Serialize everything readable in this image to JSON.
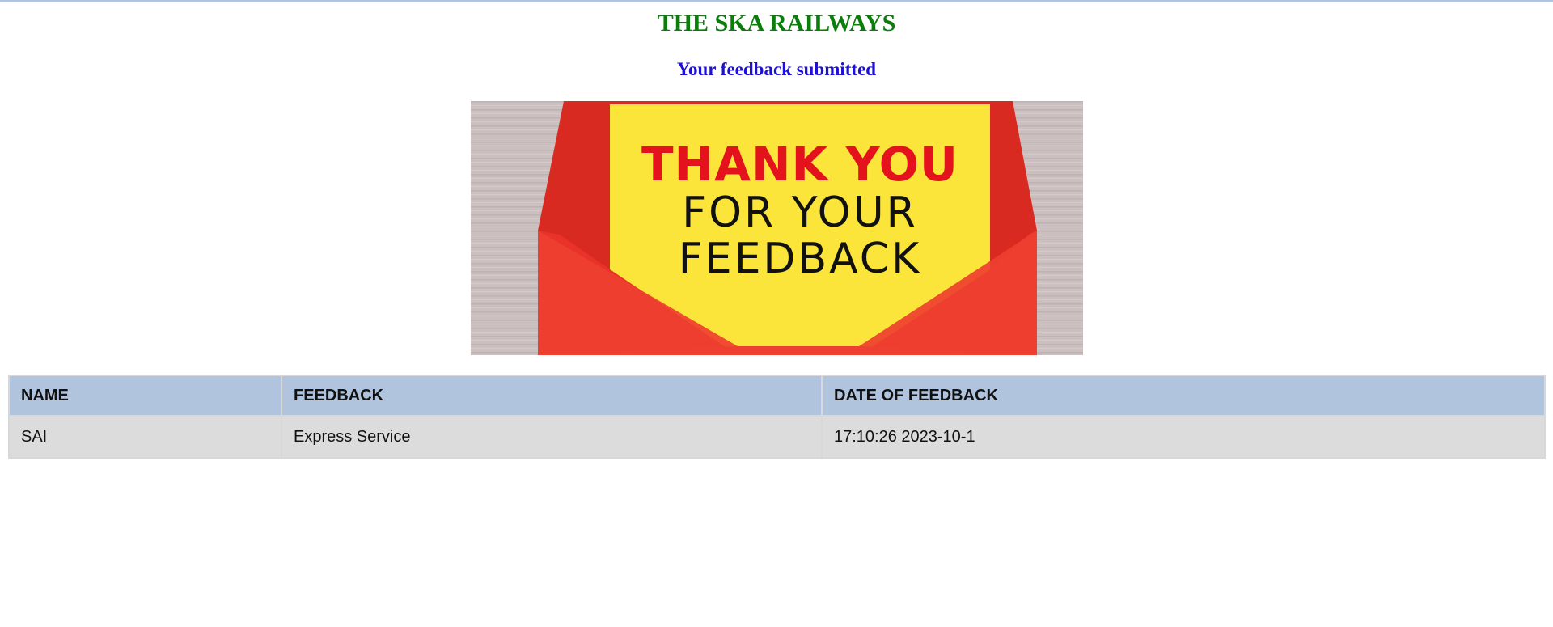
{
  "page": {
    "title": "THE SKA RAILWAYS",
    "status_message": "Your feedback submitted"
  },
  "banner_image": {
    "line1": "THANK YOU",
    "line2": "FOR YOUR",
    "line3": "FEEDBACK",
    "colors": {
      "wood": "#c9bdbd",
      "envelope": "#e8322a",
      "card": "#fbe53a",
      "accent_text": "#e4121c",
      "body_text": "#111111"
    }
  },
  "table": {
    "headers": [
      "NAME",
      "FEEDBACK",
      "DATE OF FEEDBACK"
    ],
    "rows": [
      [
        "SAI",
        "Express Service",
        "17:10:26 2023-10-1"
      ]
    ]
  },
  "colors": {
    "title": "#0a7d0a",
    "status": "#1c10d4",
    "header_bg": "#b0c4de",
    "row_bg": "#dcdcdc"
  }
}
